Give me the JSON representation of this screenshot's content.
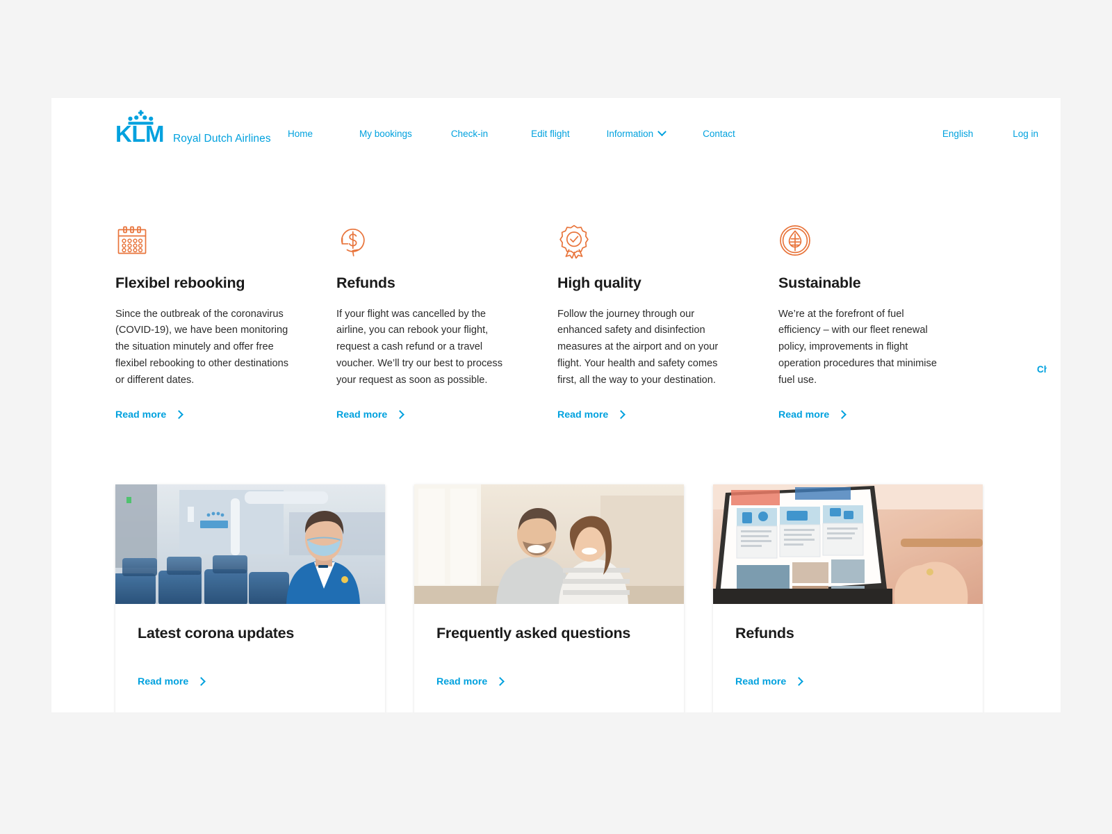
{
  "header": {
    "brand": {
      "logo_text": "KLM",
      "tagline": "Royal Dutch Airlines",
      "logo_color": "#00a1de",
      "icon": "klm-crown-icon"
    },
    "nav": [
      {
        "label": "Home",
        "icon": null
      },
      {
        "label": "My bookings",
        "icon": null
      },
      {
        "label": "Check-in",
        "icon": null
      },
      {
        "label": "Edit flight",
        "icon": null
      },
      {
        "label": "Information",
        "icon": "chevron-down-icon"
      },
      {
        "label": "Contact",
        "icon": null
      }
    ],
    "utils": [
      {
        "label": "English"
      },
      {
        "label": "Log in"
      }
    ]
  },
  "features": [
    {
      "icon": "calendar-icon",
      "title": "Flexibel rebooking",
      "body": "Since the outbreak of the coronavirus (COVID-19), we have been monitoring the situation minutely and offer free flexibel rebooking to other destinations or different dates.",
      "link": "Read more"
    },
    {
      "icon": "refund-dollar-icon",
      "title": "Refunds",
      "body": "If your flight was cancelled by the airline, you can rebook your flight, request a cash refund or a travel voucher.  We’ll try our best to process your request as soon as possible.",
      "link": "Read more"
    },
    {
      "icon": "quality-badge-icon",
      "title": "High quality",
      "body": "Follow the journey through our enhanced safety and disinfection measures at the airport and on your flight. Your health and safety comes first, all the way to your destination.",
      "link": "Read more"
    },
    {
      "icon": "leaf-circle-icon",
      "title": "Sustainable",
      "body": "We’re at the forefront of fuel efficiency – with our fleet renewal policy, improvements in flight operation procedures that minimise fuel use.",
      "link": "Read more"
    }
  ],
  "cards": [
    {
      "image": "klm-cabin-crew-with-face-mask-photo",
      "title": "Latest corona updates",
      "link": "Read more"
    },
    {
      "image": "smiling-couple-on-couch-photo",
      "title": "Frequently asked questions",
      "link": "Read more"
    },
    {
      "image": "hands-typing-on-laptop-website-photo",
      "title": "Refunds",
      "link": "Read more"
    }
  ],
  "chat_tab": {
    "label": "Chat"
  },
  "colors": {
    "brand_blue": "#00a1de",
    "accent_orange": "#e8743b",
    "text_dark": "#1a1a1a",
    "page_bg": "#f4f4f4"
  }
}
